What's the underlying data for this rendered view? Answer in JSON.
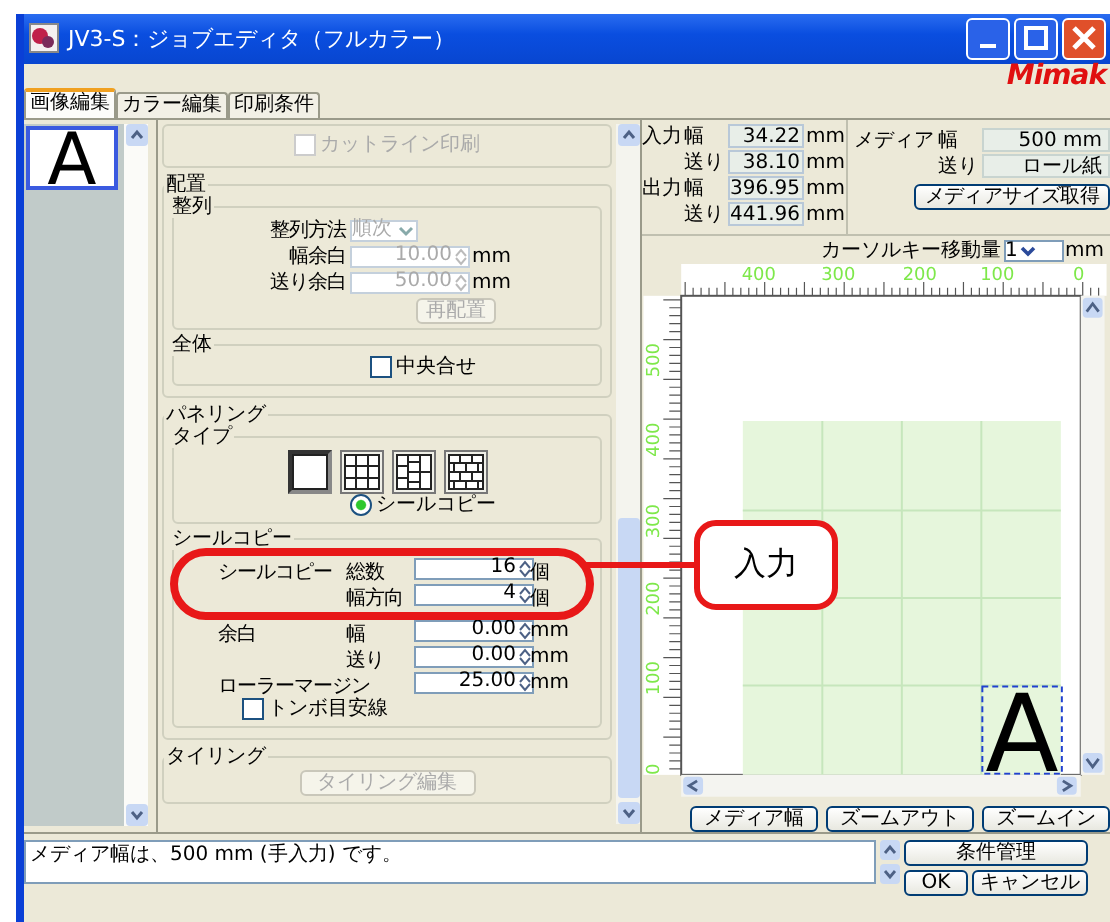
{
  "window": {
    "title": "JV3-S：ジョブエディタ（フルカラー）",
    "logo": "Mimak"
  },
  "tabs": [
    {
      "label": "画像編集",
      "selected": true
    },
    {
      "label": "カラー編集",
      "selected": false
    },
    {
      "label": "印刷条件",
      "selected": false
    }
  ],
  "thumbnails": [
    {
      "letter": "A",
      "selected": true
    }
  ],
  "cutline": {
    "label": "カットライン印刷",
    "checked": false,
    "disabled": true
  },
  "layout": {
    "title": "配置",
    "align": {
      "title": "整列",
      "fields": [
        {
          "kind": "select",
          "label": "整列方法",
          "value": "順次",
          "disabled": true
        },
        {
          "kind": "spin",
          "label": "幅余白",
          "value": "10.00",
          "unit": "mm",
          "disabled": true
        },
        {
          "kind": "spin",
          "label": "送り余白",
          "value": "50.00",
          "unit": "mm",
          "disabled": true
        }
      ],
      "button": {
        "label": "再配置",
        "disabled": true
      }
    },
    "whole": {
      "title": "全体",
      "checkbox": {
        "label": "中央合せ",
        "checked": false
      }
    }
  },
  "paneling": {
    "title": "パネリング",
    "type": {
      "title": "タイプ",
      "options": [
        {
          "kind": "single",
          "selected": true
        },
        {
          "kind": "grid",
          "selected": false
        },
        {
          "kind": "mixed",
          "selected": false
        },
        {
          "kind": "brick",
          "selected": false
        }
      ],
      "radio": {
        "label": "シールコピー",
        "selected": true
      }
    },
    "seal_copy": {
      "title": "シールコピー",
      "fields": [
        {
          "group": "シールコピー",
          "label": "総数",
          "value": "16",
          "unit": "個"
        },
        {
          "label": "幅方向",
          "value": "4",
          "unit": "個"
        },
        {
          "group": "余白",
          "label": "幅",
          "value": "0.00",
          "unit": "mm"
        },
        {
          "label": "送り",
          "value": "0.00",
          "unit": "mm"
        },
        {
          "group": "ローラーマージン",
          "value": "25.00",
          "unit": "mm"
        }
      ],
      "checkbox": {
        "label": "トンボ目安線",
        "checked": false
      }
    }
  },
  "tiling": {
    "title": "タイリング",
    "button": {
      "label": "タイリング編集",
      "disabled": true
    }
  },
  "size_info": [
    {
      "group": "入力",
      "label": "幅",
      "value": "34.22",
      "unit": "mm"
    },
    {
      "label": "送り",
      "value": "38.10",
      "unit": "mm"
    },
    {
      "group": "出力",
      "label": "幅",
      "value": "396.95",
      "unit": "mm"
    },
    {
      "label": "送り",
      "value": "441.96",
      "unit": "mm"
    }
  ],
  "media": {
    "rows": [
      {
        "group": "メディア",
        "label": "幅",
        "value": "500 mm"
      },
      {
        "label": "送り",
        "value": "ロール紙"
      }
    ],
    "button": "メディアサイズ取得"
  },
  "cursor_step": {
    "label": "カーソルキー移動量",
    "value": "1",
    "unit": "mm"
  },
  "ruler": {
    "x_labels": [
      "400",
      "300",
      "200",
      "100",
      "0"
    ],
    "y_labels": [
      "500",
      "400",
      "300",
      "200",
      "100",
      "0"
    ]
  },
  "preview": {
    "letter": "A"
  },
  "view_buttons": [
    "メディア幅",
    "ズームアウト",
    "ズームイン"
  ],
  "status": {
    "message": "メディア幅は、500 mm (手入力) です。"
  },
  "actions": {
    "manage": "条件管理",
    "ok": "OK",
    "cancel": "キャンセル"
  },
  "callout": {
    "label": "入力"
  }
}
